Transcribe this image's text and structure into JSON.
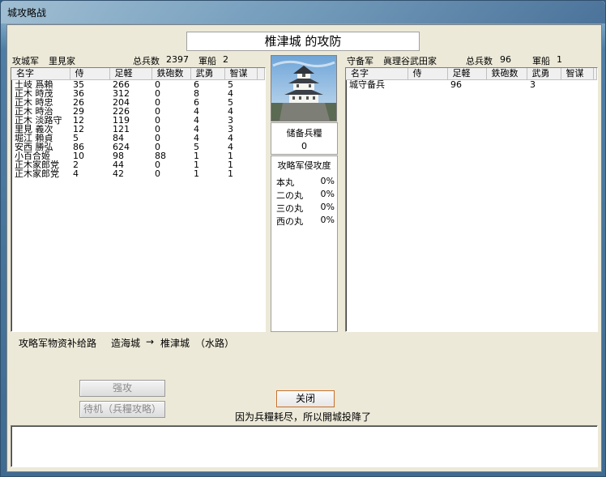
{
  "window": {
    "title": "城攻略战"
  },
  "castle_title": "椎津城 的攻防",
  "attacker": {
    "label": "攻城军",
    "clan": "里見家",
    "total_label": "总兵数",
    "total": "2397",
    "ships_label": "軍船",
    "ships": "2",
    "columns": [
      "名字",
      "侍",
      "足軽",
      "鉄砲数",
      "武勇",
      "智谋"
    ],
    "rows": [
      [
        "土岐 爲賴",
        "35",
        "266",
        "0",
        "6",
        "5"
      ],
      [
        "正木 時茂",
        "36",
        "312",
        "0",
        "8",
        "4"
      ],
      [
        "正木 時忠",
        "26",
        "204",
        "0",
        "6",
        "5"
      ],
      [
        "正木 時治",
        "29",
        "226",
        "0",
        "4",
        "4"
      ],
      [
        "正木 淡路守",
        "12",
        "119",
        "0",
        "4",
        "3"
      ],
      [
        "里見 義次",
        "12",
        "121",
        "0",
        "4",
        "3"
      ],
      [
        "堀江 賴貞",
        "5",
        "84",
        "0",
        "4",
        "4"
      ],
      [
        "安西 勝弘",
        "86",
        "624",
        "0",
        "5",
        "4"
      ],
      [
        "小百合姬",
        "10",
        "98",
        "88",
        "1",
        "1"
      ],
      [
        "正木家郎党",
        "2",
        "44",
        "0",
        "1",
        "1"
      ],
      [
        "正木家郎党",
        "4",
        "42",
        "0",
        "1",
        "1"
      ]
    ]
  },
  "defender": {
    "label": "守备军",
    "clan": "眞理谷武田家",
    "total_label": "总兵数",
    "total": "96",
    "ships_label": "軍船",
    "ships": "1",
    "columns": [
      "名字",
      "侍",
      "足軽",
      "鉄砲数",
      "武勇",
      "智谋"
    ],
    "rows": [
      [
        "城守备兵",
        "",
        "96",
        "",
        "3",
        ""
      ]
    ]
  },
  "center": {
    "reserve_label": "储备兵糧",
    "reserve_value": "0",
    "progress_title": "攻略军侵攻度",
    "progress": [
      {
        "name": "本丸",
        "value": "0%"
      },
      {
        "name": "二の丸",
        "value": "0%"
      },
      {
        "name": "三の丸",
        "value": "0%"
      },
      {
        "name": "西の丸",
        "value": "0%"
      }
    ]
  },
  "supply_route": {
    "label": "攻略军物资补给路",
    "from": "造海城",
    "arrow": "→",
    "to": "椎津城",
    "mode": "（水路）"
  },
  "buttons": {
    "assault": "强攻",
    "wait": "待机（兵糧攻略）",
    "close": "关闭"
  },
  "status_message": "因为兵糧耗尽，所以開城投降了",
  "colors": {
    "window_bg": "#ece9d8",
    "focus_border": "#c86f2a",
    "disabled_text": "#8a8a8a"
  }
}
